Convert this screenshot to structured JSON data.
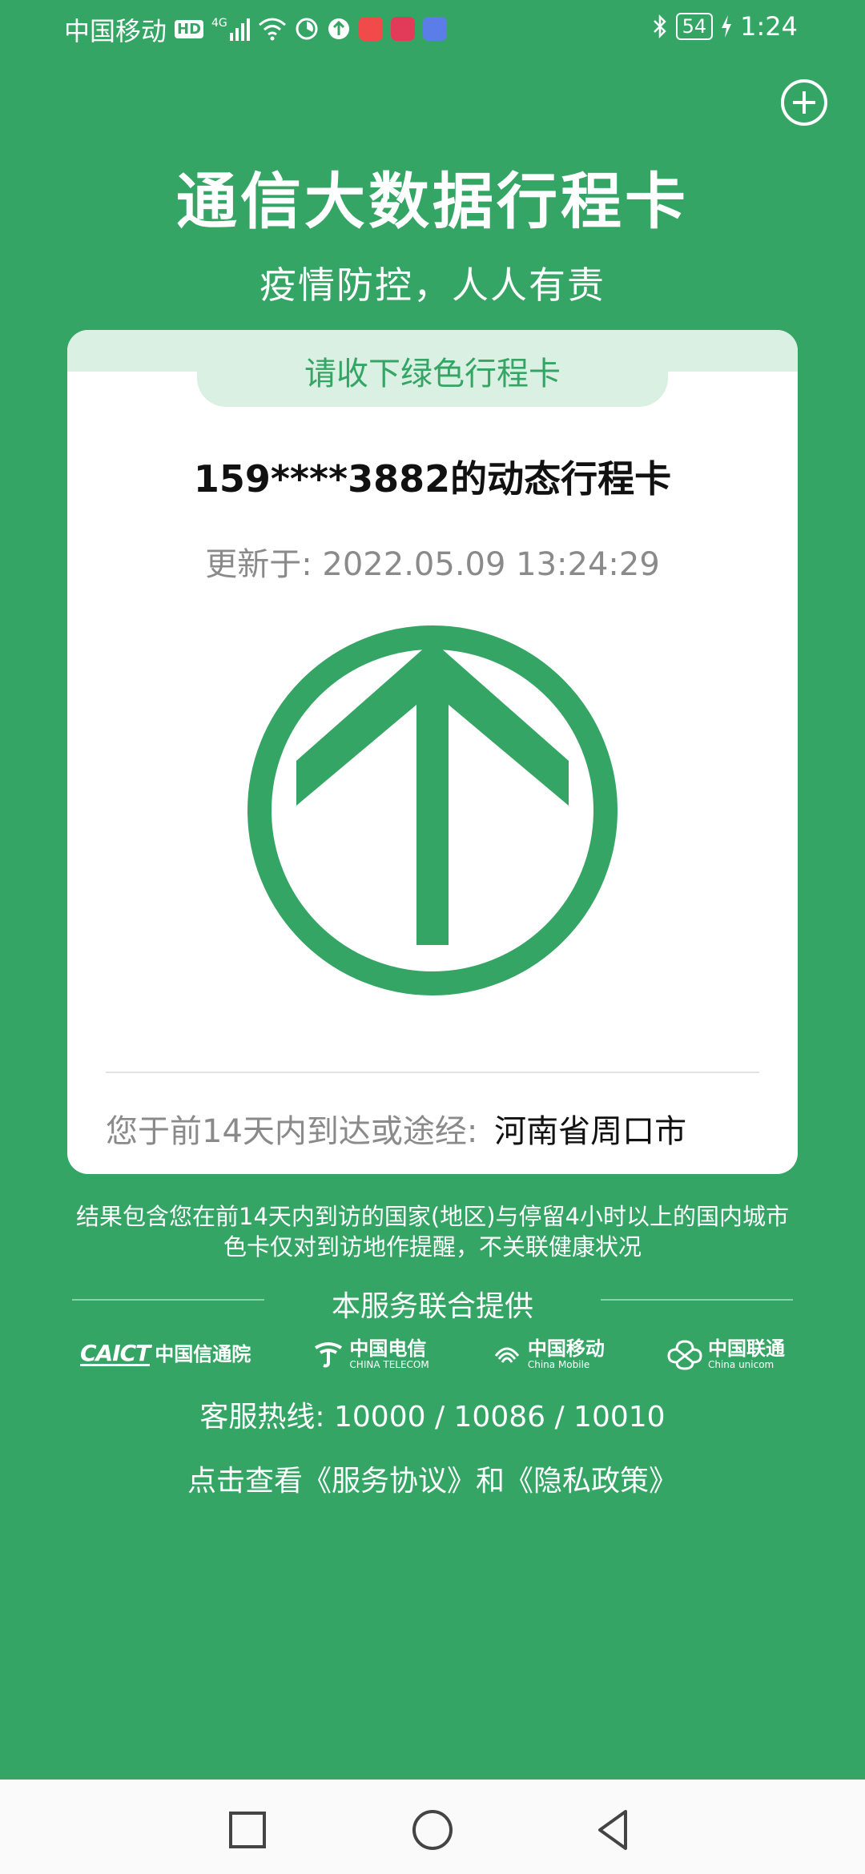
{
  "status_bar": {
    "carrier": "中国移动",
    "hd_badge": "HD",
    "network": "4G",
    "battery": "54",
    "time": "1:24",
    "icons": [
      "hd-badge-icon",
      "cellular-signal-icon",
      "wifi-icon",
      "timer-icon",
      "app-icon",
      "app-store-icon",
      "health-app-icon",
      "music-app-icon",
      "bluetooth-icon",
      "battery-icon",
      "charging-icon"
    ]
  },
  "header": {
    "add_icon": "plus-circle-icon",
    "title": "通信大数据行程卡",
    "subtitle": "疫情防控，人人有责"
  },
  "card": {
    "tab_label": "请收下绿色行程卡",
    "phone_title": "159****3882的动态行程卡",
    "update_label": "更新于:",
    "update_time": "2022.05.09 13:24:29",
    "status_icon": "green-up-arrow-icon",
    "route_label": "您于前14天内到达或途经:",
    "route_value": "河南省周口市"
  },
  "notes": {
    "line1": "结果包含您在前14天内到访的国家(地区)与停留4小时以上的国内城市",
    "line2": "色卡仅对到访地作提醒，不关联健康状况"
  },
  "providers": {
    "title": "本服务联合提供",
    "caict": {
      "mark": "CAICT",
      "name": "中国信通院"
    },
    "telecom": {
      "zh": "中国电信",
      "en": "CHINA TELECOM"
    },
    "mobile": {
      "zh": "中国移动",
      "en": "China Mobile"
    },
    "unicom": {
      "zh": "中国联通",
      "en": "China unicom"
    }
  },
  "hotline": "客服热线:  10000 / 10086 / 10010",
  "agreement": "点击查看《服务协议》和《隐私政策》",
  "nav": {
    "recent_icon": "square-recent-icon",
    "home_icon": "circle-home-icon",
    "back_icon": "triangle-back-icon"
  },
  "colors": {
    "background": "#35a565",
    "accent_light": "#d9f0e3",
    "card": "#ffffff"
  }
}
